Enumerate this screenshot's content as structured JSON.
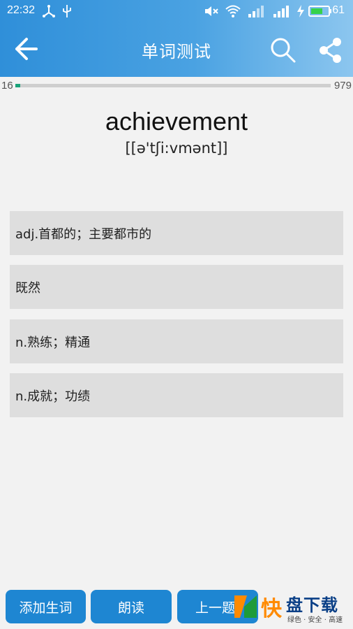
{
  "status": {
    "time": "22:32",
    "battery": "61"
  },
  "appbar": {
    "title": "单词测试"
  },
  "progress": {
    "current": "16",
    "total": "979",
    "fraction": 0.016
  },
  "quiz": {
    "word": "achievement",
    "phonetic": "[[ə'tʃi:vmənt]]",
    "options": [
      "adj.首都的；主要都市的",
      "既然",
      "n.熟练；精通",
      "n.成就；功绩"
    ]
  },
  "buttons": {
    "add": "添加生词",
    "read": "朗读",
    "prev": "上一题"
  },
  "watermark": {
    "kuai": "快",
    "main": "盘下载",
    "sub": "绿色 · 安全 · 高速"
  },
  "colors": {
    "accent": "#1e86d2",
    "progress": "#1aa37a",
    "option_bg": "#dedede"
  }
}
